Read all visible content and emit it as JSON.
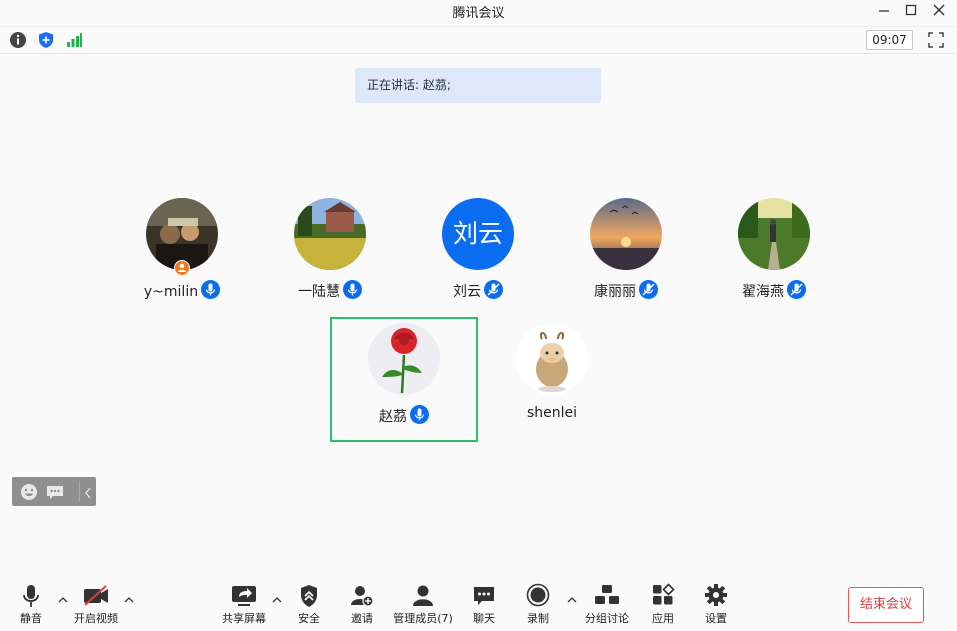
{
  "window": {
    "title": "腾讯会议"
  },
  "toolbar": {
    "time": "09:07"
  },
  "speaking_banner": {
    "text": "正在讲话: 赵茘;"
  },
  "participants": [
    {
      "name": "y~milin",
      "mic": "on"
    },
    {
      "name": "一陆慧",
      "mic": "on"
    },
    {
      "name": "刘云",
      "avatar_text": "刘云",
      "mic": "muted"
    },
    {
      "name": "康丽丽",
      "mic": "muted"
    },
    {
      "name": "翟海燕",
      "mic": "muted"
    },
    {
      "name": "赵茘",
      "mic": "on"
    },
    {
      "name": "shenlei"
    }
  ],
  "bottom_bar": {
    "mute": "静音",
    "video": "开启视频",
    "share": "共享屏幕",
    "security": "安全",
    "invite": "邀请",
    "members": "管理成员(7)",
    "chat": "聊天",
    "record": "录制",
    "breakout": "分组讨论",
    "apps": "应用",
    "settings": "设置",
    "end": "结束会议"
  },
  "colors": {
    "accent": "#0a6cf1",
    "end": "#e03c3c",
    "active_border": "#2bc06a"
  }
}
